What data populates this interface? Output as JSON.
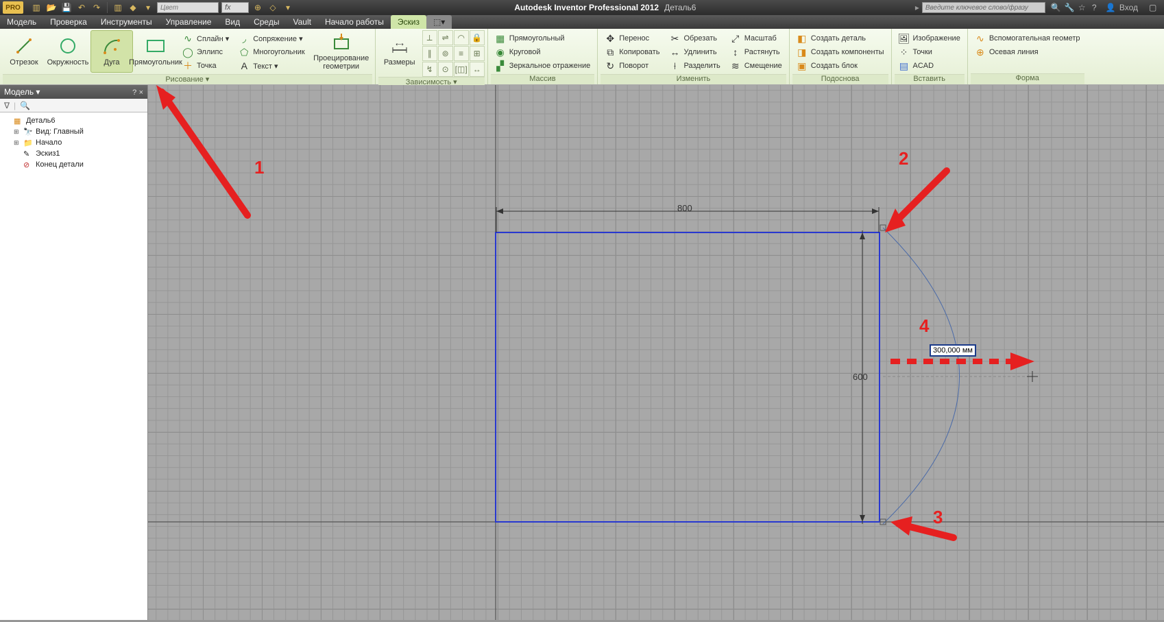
{
  "title": {
    "app": "Autodesk Inventor Professional 2012",
    "doc": "Деталь6"
  },
  "qat": {
    "color_placeholder": "Цвет",
    "fx": "fx"
  },
  "search_placeholder": "Введите ключевое слово/фразу",
  "login_label": "Вход",
  "menus": [
    "Модель",
    "Проверка",
    "Инструменты",
    "Управление",
    "Вид",
    "Среды",
    "Vault",
    "Начало работы",
    "Эскиз"
  ],
  "menu_active_index": 8,
  "ribbon": {
    "groups": {
      "draw": {
        "title": "Рисование ▾",
        "big": [
          {
            "name": "segment",
            "label": "Отрезок"
          },
          {
            "name": "circle",
            "label": "Окружность"
          },
          {
            "name": "arc",
            "label": "Дуга",
            "active": true
          },
          {
            "name": "rectangle",
            "label": "Прямоугольник"
          }
        ],
        "small": [
          {
            "name": "spline",
            "label": "Сплайн ▾",
            "icon": "∿"
          },
          {
            "name": "ellipse",
            "label": "Эллипс",
            "icon": "◯"
          },
          {
            "name": "point",
            "label": "Точка",
            "icon": "＋"
          },
          {
            "name": "fillet",
            "label": "Сопряжение ▾",
            "icon": "◞"
          },
          {
            "name": "polygon",
            "label": "Многоугольник",
            "icon": "⬠"
          },
          {
            "name": "text",
            "label": "Текст ▾",
            "icon": "A"
          }
        ],
        "project": {
          "label": "Проецирование геометрии"
        }
      },
      "constraint": {
        "title": "Зависимость ▾",
        "dim_label": "Размеры"
      },
      "pattern": {
        "title": "Массив",
        "items": [
          {
            "name": "rect-pattern",
            "label": "Прямоугольный",
            "icon": "▦"
          },
          {
            "name": "circ-pattern",
            "label": "Круговой",
            "icon": "◉"
          },
          {
            "name": "mirror",
            "label": "Зеркальное отражение",
            "icon": "▞"
          }
        ]
      },
      "modify": {
        "title": "Изменить",
        "cols": [
          [
            {
              "name": "move",
              "label": "Перенос",
              "icon": "✥"
            },
            {
              "name": "copy",
              "label": "Копировать",
              "icon": "⧉"
            },
            {
              "name": "rotate",
              "label": "Поворот",
              "icon": "↻"
            }
          ],
          [
            {
              "name": "trim",
              "label": "Обрезать",
              "icon": "✂"
            },
            {
              "name": "extend",
              "label": "Удлинить",
              "icon": "↔"
            },
            {
              "name": "split",
              "label": "Разделить",
              "icon": "⟊"
            }
          ],
          [
            {
              "name": "scale",
              "label": "Масштаб",
              "icon": "⤢"
            },
            {
              "name": "stretch",
              "label": "Растянуть",
              "icon": "↕"
            },
            {
              "name": "offset",
              "label": "Смещение",
              "icon": "≋"
            }
          ]
        ]
      },
      "layout": {
        "title": "Подоснова",
        "items": [
          {
            "name": "make-part",
            "label": "Создать деталь",
            "icon": "◧"
          },
          {
            "name": "make-comp",
            "label": "Создать компоненты",
            "icon": "◨"
          },
          {
            "name": "make-block",
            "label": "Создать блок",
            "icon": "▣"
          }
        ]
      },
      "insert": {
        "title": "Вставить",
        "items": [
          {
            "name": "image",
            "label": "Изображение",
            "icon": "🖼"
          },
          {
            "name": "points",
            "label": "Точки",
            "icon": "⁘"
          },
          {
            "name": "acad",
            "label": "ACAD",
            "icon": "▤"
          }
        ]
      },
      "format": {
        "title": "Форма",
        "items": [
          {
            "name": "construction",
            "label": "Вспомогательная геометр",
            "icon": "∿"
          },
          {
            "name": "centerline",
            "label": "Осевая линия",
            "icon": "⊕"
          }
        ]
      }
    }
  },
  "browser": {
    "title": "Модель ▾",
    "nodes": [
      {
        "icon": "📄",
        "label": "Деталь6",
        "indent": 0,
        "exp": ""
      },
      {
        "icon": "🔍",
        "label": "Вид: Главный",
        "indent": 1,
        "exp": "⊞"
      },
      {
        "icon": "📁",
        "label": "Начало",
        "indent": 1,
        "exp": "⊞"
      },
      {
        "icon": "✎",
        "label": "Эскиз1",
        "indent": 1,
        "exp": ""
      },
      {
        "icon": "⊘",
        "label": "Конец детали",
        "indent": 1,
        "exp": "",
        "red": true
      }
    ]
  },
  "sketch": {
    "dim_w": "800",
    "dim_h": "600",
    "input_value": "300,000 мм"
  },
  "annotations": {
    "n1": "1",
    "n2": "2",
    "n3": "3",
    "n4": "4"
  }
}
